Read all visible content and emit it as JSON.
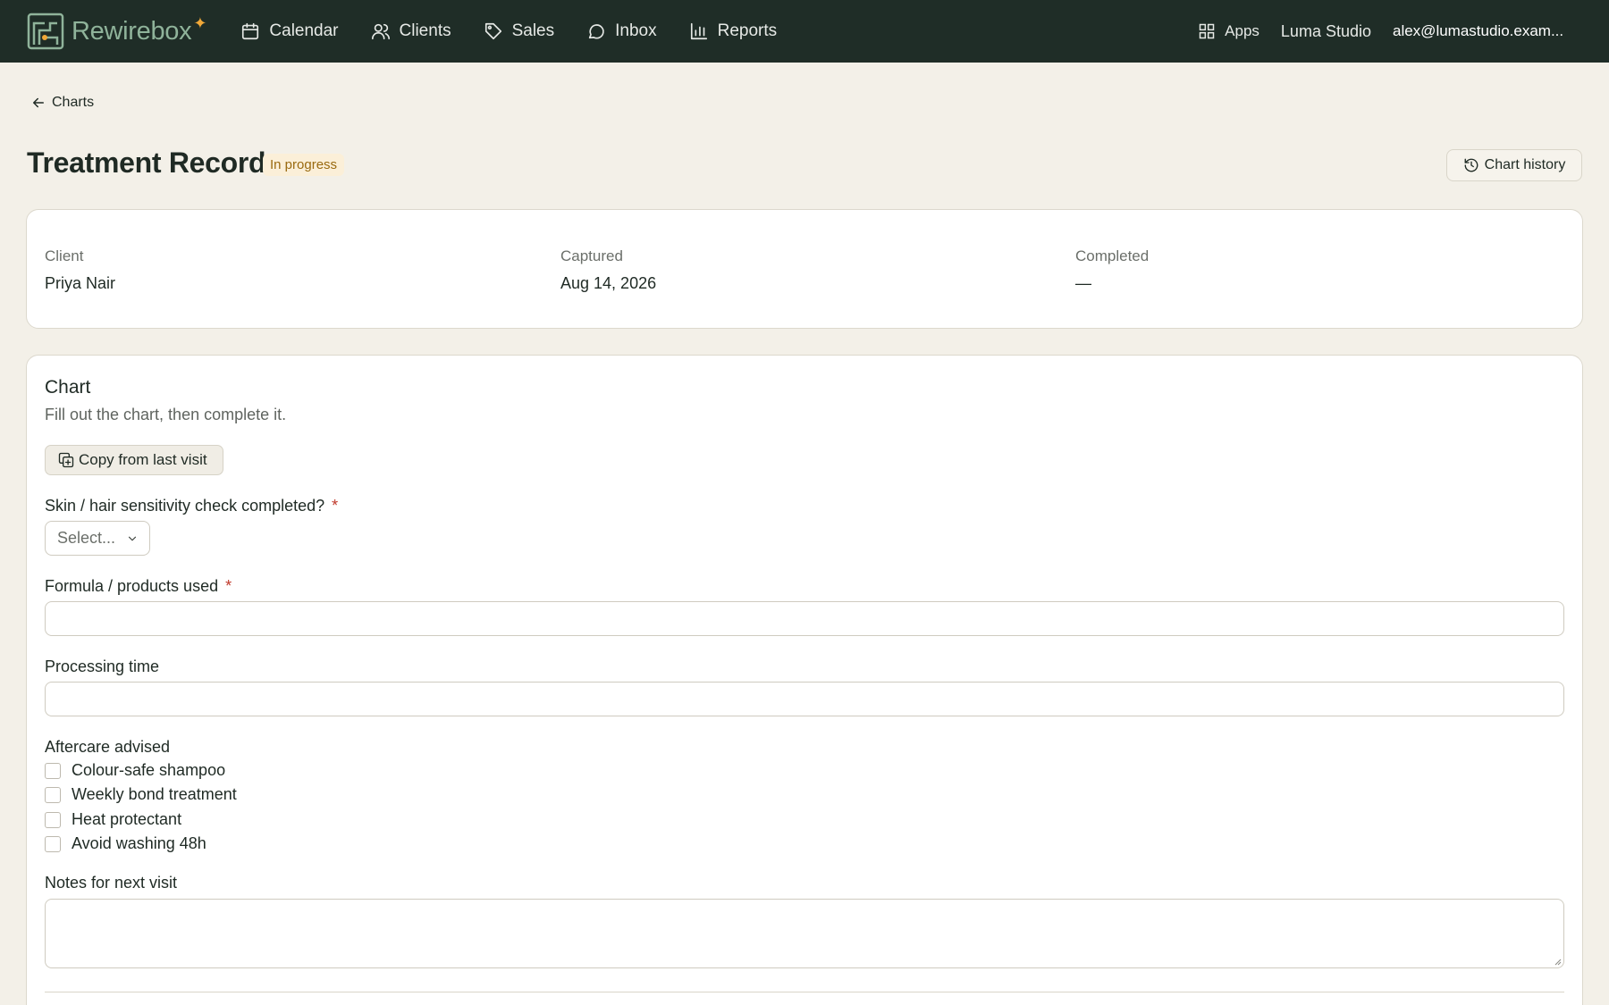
{
  "brand": {
    "name": "Rewirebox",
    "spark": "✦"
  },
  "nav": {
    "items": [
      {
        "label": "Calendar",
        "icon": "calendar-icon"
      },
      {
        "label": "Clients",
        "icon": "users-icon"
      },
      {
        "label": "Sales",
        "icon": "tag-icon"
      },
      {
        "label": "Inbox",
        "icon": "chat-bubble-icon"
      },
      {
        "label": "Reports",
        "icon": "bar-chart-icon"
      }
    ],
    "apps_label": "Apps",
    "studio": "Luma Studio",
    "user_email": "alex@lumastudio.exam..."
  },
  "back_link": {
    "label": "Charts"
  },
  "header": {
    "title": "Treatment Record",
    "status": "In progress",
    "history_button": "Chart history"
  },
  "info": {
    "client_label": "Client",
    "client_value": "Priya Nair",
    "captured_label": "Captured",
    "captured_value": "Aug 14, 2026",
    "completed_label": "Completed",
    "completed_value": "—"
  },
  "chart": {
    "title": "Chart",
    "subtitle": "Fill out the chart, then complete it.",
    "copy_button": "Copy from last visit",
    "sensitivity": {
      "label": "Skin / hair sensitivity check completed?",
      "required_mark": "*",
      "placeholder": "Select..."
    },
    "formula": {
      "label": "Formula / products used",
      "required_mark": "*",
      "value": ""
    },
    "processing": {
      "label": "Processing time",
      "value": ""
    },
    "aftercare": {
      "label": "Aftercare advised",
      "options": [
        {
          "label": "Colour-safe shampoo",
          "checked": false
        },
        {
          "label": "Weekly bond treatment",
          "checked": false
        },
        {
          "label": "Heat protectant",
          "checked": false
        },
        {
          "label": "Avoid washing 48h",
          "checked": false
        }
      ]
    },
    "notes": {
      "label": "Notes for next visit",
      "value": ""
    }
  },
  "colors": {
    "topbar": "#1f2d27",
    "background": "#f3f0e8",
    "brand_green": "#8fb39a",
    "spark": "#f0a838",
    "badge_bg": "#fbefd8",
    "badge_text": "#9a6a10",
    "required": "#c0392b"
  }
}
